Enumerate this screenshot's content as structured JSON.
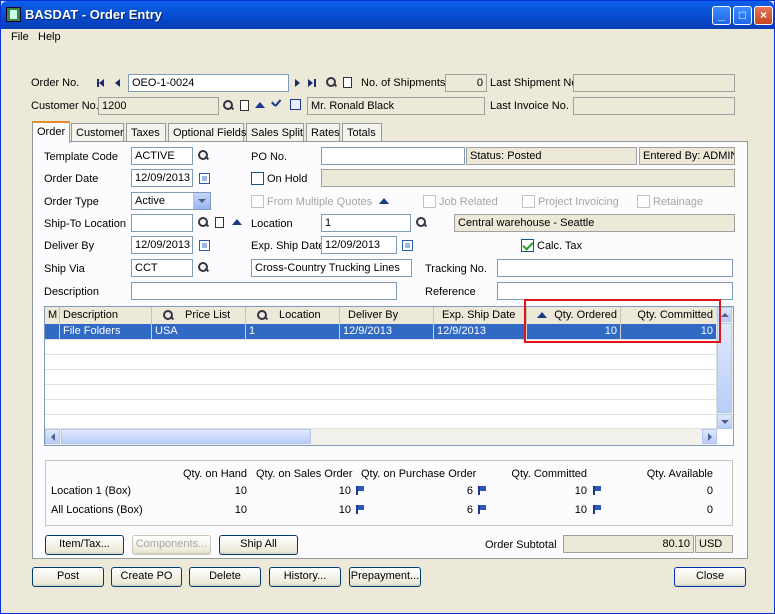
{
  "window": {
    "title": "BASDAT - Order Entry",
    "minimize_glyph": "_",
    "maximize_glyph": "□",
    "close_glyph": "×"
  },
  "menu": [
    "File",
    "Help"
  ],
  "header": {
    "order_no_label": "Order No.",
    "order_no": "OEO-1-0024",
    "no_shipments_label": "No. of Shipments",
    "no_shipments": "0",
    "last_shipment_label": "Last Shipment No.",
    "last_shipment": "",
    "customer_no_label": "Customer No.",
    "customer_no": "1200",
    "customer_name": "Mr. Ronald Black",
    "last_invoice_label": "Last Invoice No.",
    "last_invoice": ""
  },
  "tabs": [
    "Order",
    "Customer",
    "Taxes",
    "Optional Fields",
    "Sales Split",
    "Rates",
    "Totals"
  ],
  "form": {
    "template_code_label": "Template Code",
    "template_code": "ACTIVE",
    "po_no_label": "PO No.",
    "po_no": "",
    "status": "Status: Posted",
    "entered_by": "Entered By: ADMIN",
    "order_date_label": "Order Date",
    "order_date": "12/09/2013",
    "on_hold_label": "On Hold",
    "order_type_label": "Order Type",
    "order_type": "Active",
    "from_multiple_quotes_label": "From Multiple Quotes",
    "job_related_label": "Job Related",
    "project_invoicing_label": "Project Invoicing",
    "retainage_label": "Retainage",
    "ship_to_location_label": "Ship-To Location",
    "ship_to_location": "",
    "location_label": "Location",
    "location": "1",
    "location_desc": "Central warehouse - Seattle",
    "deliver_by_label": "Deliver By",
    "deliver_by": "12/09/2013",
    "exp_ship_date_label": "Exp. Ship Date",
    "exp_ship_date": "12/09/2013",
    "calc_tax_label": "Calc. Tax",
    "ship_via_label": "Ship Via",
    "ship_via": "CCT",
    "ship_via_desc": "Cross-Country Trucking Lines",
    "tracking_no_label": "Tracking No.",
    "tracking_no": "",
    "description_label": "Description",
    "description": "",
    "reference_label": "Reference",
    "reference": ""
  },
  "grid": {
    "columns": [
      "M",
      "Description",
      "Price List",
      "Location",
      "Deliver By",
      "Exp. Ship Date",
      "Qty. Ordered",
      "Qty. Committed"
    ],
    "rows": [
      [
        "",
        "File Folders",
        "USA",
        "1",
        "12/9/2013",
        "12/9/2013",
        "10",
        "10"
      ]
    ]
  },
  "summary": {
    "headers": [
      "Qty. on Hand",
      "Qty. on Sales Order",
      "Qty. on Purchase Order",
      "Qty. Committed",
      "Qty. Available"
    ],
    "rows": [
      {
        "label": "Location  1 (Box)",
        "values": [
          "10",
          "10",
          "6",
          "10",
          "0"
        ]
      },
      {
        "label": "All Locations (Box)",
        "values": [
          "10",
          "10",
          "6",
          "10",
          "0"
        ]
      }
    ]
  },
  "actions": {
    "item_tax": "Item/Tax...",
    "components": "Components...",
    "ship_all": "Ship All",
    "order_subtotal_label": "Order Subtotal",
    "order_subtotal": "80.10",
    "currency": "USD"
  },
  "bottom_buttons": {
    "post": "Post",
    "create_po": "Create PO",
    "delete": "Delete",
    "history": "History...",
    "prepayment": "Prepayment...",
    "close": "Close"
  },
  "colors": {
    "title_bar": "#0853d6",
    "selected_row": "#316ac5",
    "highlight_box": "#e0161a",
    "tab_accent": "#e68b2c"
  }
}
